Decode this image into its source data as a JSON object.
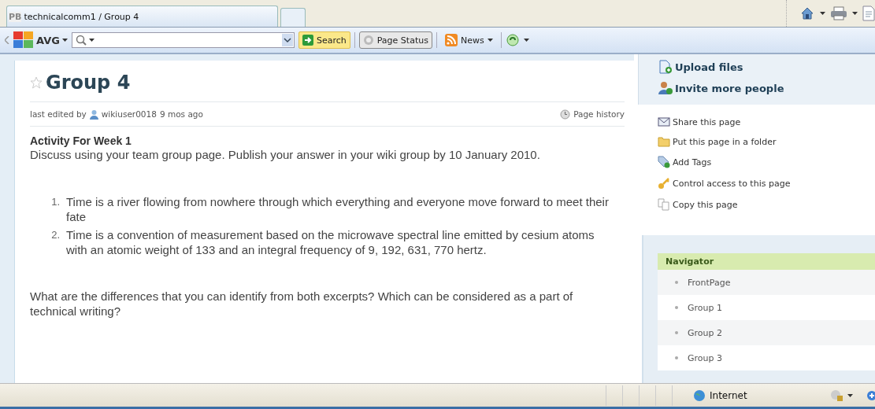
{
  "browser": {
    "tab": {
      "favicon": "PB",
      "title": "technicalcomm1 / Group 4",
      "selected": true
    },
    "toolbar": {
      "brand": "AVG",
      "search_button": "Search",
      "page_status": "Page Status",
      "news": "News"
    }
  },
  "page": {
    "title": "Group 4",
    "starred": false,
    "meta": {
      "prefix": "last edited by",
      "user": "wikiuser0018",
      "time": "9 mos ago",
      "history": "Page history"
    },
    "heading": "Activity For  Week 1",
    "intro": "Discuss using your team group page. Publish your answer in your wiki group by 10 January 2010.",
    "excerpts": [
      {
        "marker": "1.",
        "text": "Time is a river flowing from nowhere through which everything and everyone move forward to meet their fate"
      },
      {
        "marker": "2.",
        "text": " Time is a convention of measurement based on the microwave spectral line emitted by cesium atoms with an atomic weight of 133 and an integral frequency of 9, 192, 631, 770 hertz."
      }
    ],
    "question": "What are the differences that you can identify from both excerpts? Which can be considered as a part of technical writing?"
  },
  "sidebar": {
    "primary_actions": [
      {
        "kind": "upload",
        "label": "Upload files"
      },
      {
        "kind": "invite",
        "label": "Invite more people"
      }
    ],
    "actions": [
      {
        "kind": "share",
        "label": "Share this page"
      },
      {
        "kind": "folder",
        "label": "Put this page in a folder"
      },
      {
        "kind": "tags",
        "label": "Add Tags"
      },
      {
        "kind": "key",
        "label": "Control access to this page"
      },
      {
        "kind": "copy",
        "label": "Copy this page"
      }
    ],
    "navigator": {
      "title": "Navigator",
      "items": [
        "FrontPage",
        "Group 1",
        "Group 2",
        "Group 3"
      ]
    }
  },
  "status_bar": {
    "zone": "Internet"
  }
}
